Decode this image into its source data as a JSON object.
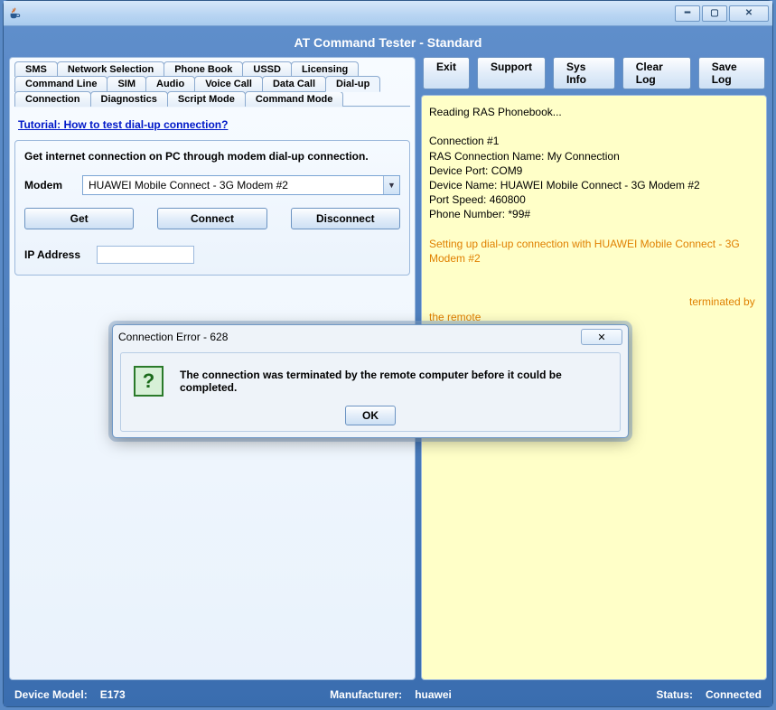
{
  "app_title": "AT Command Tester - Standard",
  "top_buttons": {
    "exit": "Exit",
    "support": "Support",
    "sys_info": "Sys Info",
    "clear_log": "Clear Log",
    "save_log": "Save Log"
  },
  "tabs_row1": [
    "SMS",
    "Network Selection",
    "Phone Book",
    "USSD",
    "Licensing"
  ],
  "tabs_row2": [
    "Command Line",
    "SIM",
    "Audio",
    "Voice Call",
    "Data Call",
    "Dial-up"
  ],
  "tabs_row3": [
    "Connection",
    "Diagnostics",
    "Script Mode",
    "Command Mode"
  ],
  "active_tab": "Dial-up",
  "tutorial_link": "Tutorial: How to test dial-up connection?",
  "group": {
    "title": "Get internet connection on PC through modem dial-up connection.",
    "modem_label": "Modem",
    "modem_value": "HUAWEI Mobile Connect - 3G Modem #2",
    "get": "Get",
    "connect": "Connect",
    "disconnect": "Disconnect",
    "ip_label": "IP Address",
    "ip_value": ""
  },
  "log": {
    "line1": "Reading RAS Phonebook...",
    "blank": "",
    "line2": "Connection #1",
    "line3": "RAS Connection Name: My Connection",
    "line4": "Device Port: COM9",
    "line5": "Device Name: HUAWEI Mobile Connect - 3G Modem #2",
    "line6": "Port Speed: 460800",
    "line7": "Phone Number: *99#",
    "orange1": "Setting up dial-up connection with HUAWEI Mobile Connect - 3G Modem #2",
    "orange2_tail": "terminated by the remote"
  },
  "dialog": {
    "title": "Connection Error - 628",
    "message": "The connection was terminated by the remote computer before it could be completed.",
    "ok": "OK",
    "close_glyph": "✕"
  },
  "status": {
    "model_label": "Device Model:",
    "model_value": "E173",
    "mfr_label": "Manufacturer:",
    "mfr_value": "huawei",
    "status_label": "Status:",
    "status_value": "Connected"
  }
}
